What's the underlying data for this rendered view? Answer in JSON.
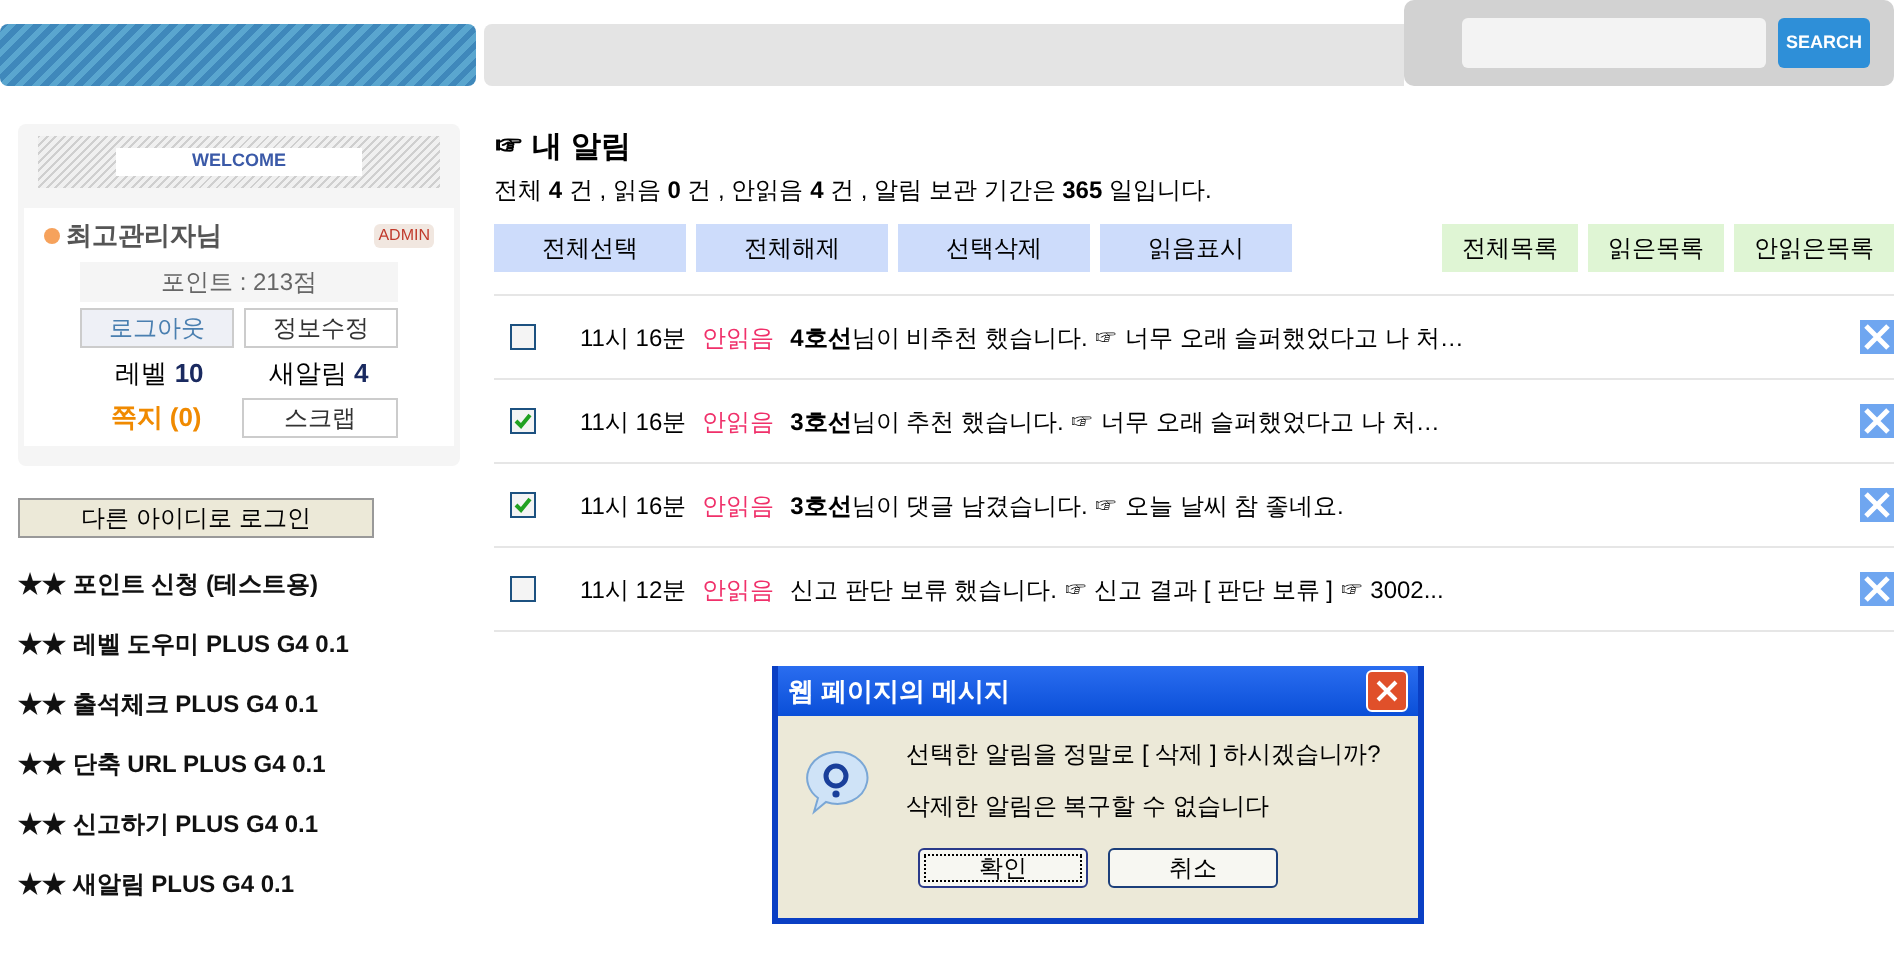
{
  "header": {
    "search_button": "SEARCH"
  },
  "profile": {
    "welcome": "WELCOME",
    "name": "최고관리자님",
    "badge": "ADMIN",
    "points": "포인트 : 213점",
    "logout": "로그아웃",
    "edit": "정보수정",
    "level_label": "레벨",
    "level_value": "10",
    "alerts_label": "새알림",
    "alerts_value": "4",
    "memo": "쪽지 (0)",
    "scrap": "스크랩"
  },
  "other_login": "다른 아이디로 로그인",
  "side_links": [
    "★★ 포인트 신청 (테스트용)",
    "★★ 레벨 도우미 PLUS G4 0.1",
    "★★ 출석체크 PLUS G4 0.1",
    "★★ 단축 URL PLUS G4 0.1",
    "★★ 신고하기 PLUS G4 0.1",
    "★★ 새알림 PLUS G4 0.1"
  ],
  "title": "☞ 내 알림",
  "summary": "전체 **4** 건 , 읽음 **0** 건 , 안읽음 **4** 건 , 알림 보관 기간은 **365** 일입니다.",
  "actions": [
    "전체선택",
    "전체해제",
    "선택삭제",
    "읽음표시"
  ],
  "filters": [
    "전체목록",
    "읽은목록",
    "안읽은목록"
  ],
  "alerts": [
    {
      "checked": false,
      "time": "11시 16분",
      "status": "안읽음",
      "message": "**4호선**님이 비추천 했습니다. ☞ 너무 오래 슬퍼했었다고 나 처…"
    },
    {
      "checked": true,
      "time": "11시 16분",
      "status": "안읽음",
      "message": "**3호선**님이 추천 했습니다. ☞ 너무 오래 슬퍼했었다고 나 처…"
    },
    {
      "checked": true,
      "time": "11시 16분",
      "status": "안읽음",
      "message": "**3호선**님이 댓글 남겼습니다. ☞ 오늘 날씨 참 좋네요."
    },
    {
      "checked": false,
      "time": "11시 12분",
      "status": "안읽음",
      "message": "신고 판단 보류 했습니다. ☞ 신고 결과 [ 판단 보류 ] ☞ 3002..."
    }
  ],
  "dialog": {
    "title": "웹 페이지의 메시지",
    "lines": [
      "선택한 알림을 정말로 [ 삭제 ] 하시겠습니까?",
      "삭제한 알림은 복구할 수 없습니다"
    ],
    "buttons": [
      "확인",
      "취소"
    ]
  }
}
